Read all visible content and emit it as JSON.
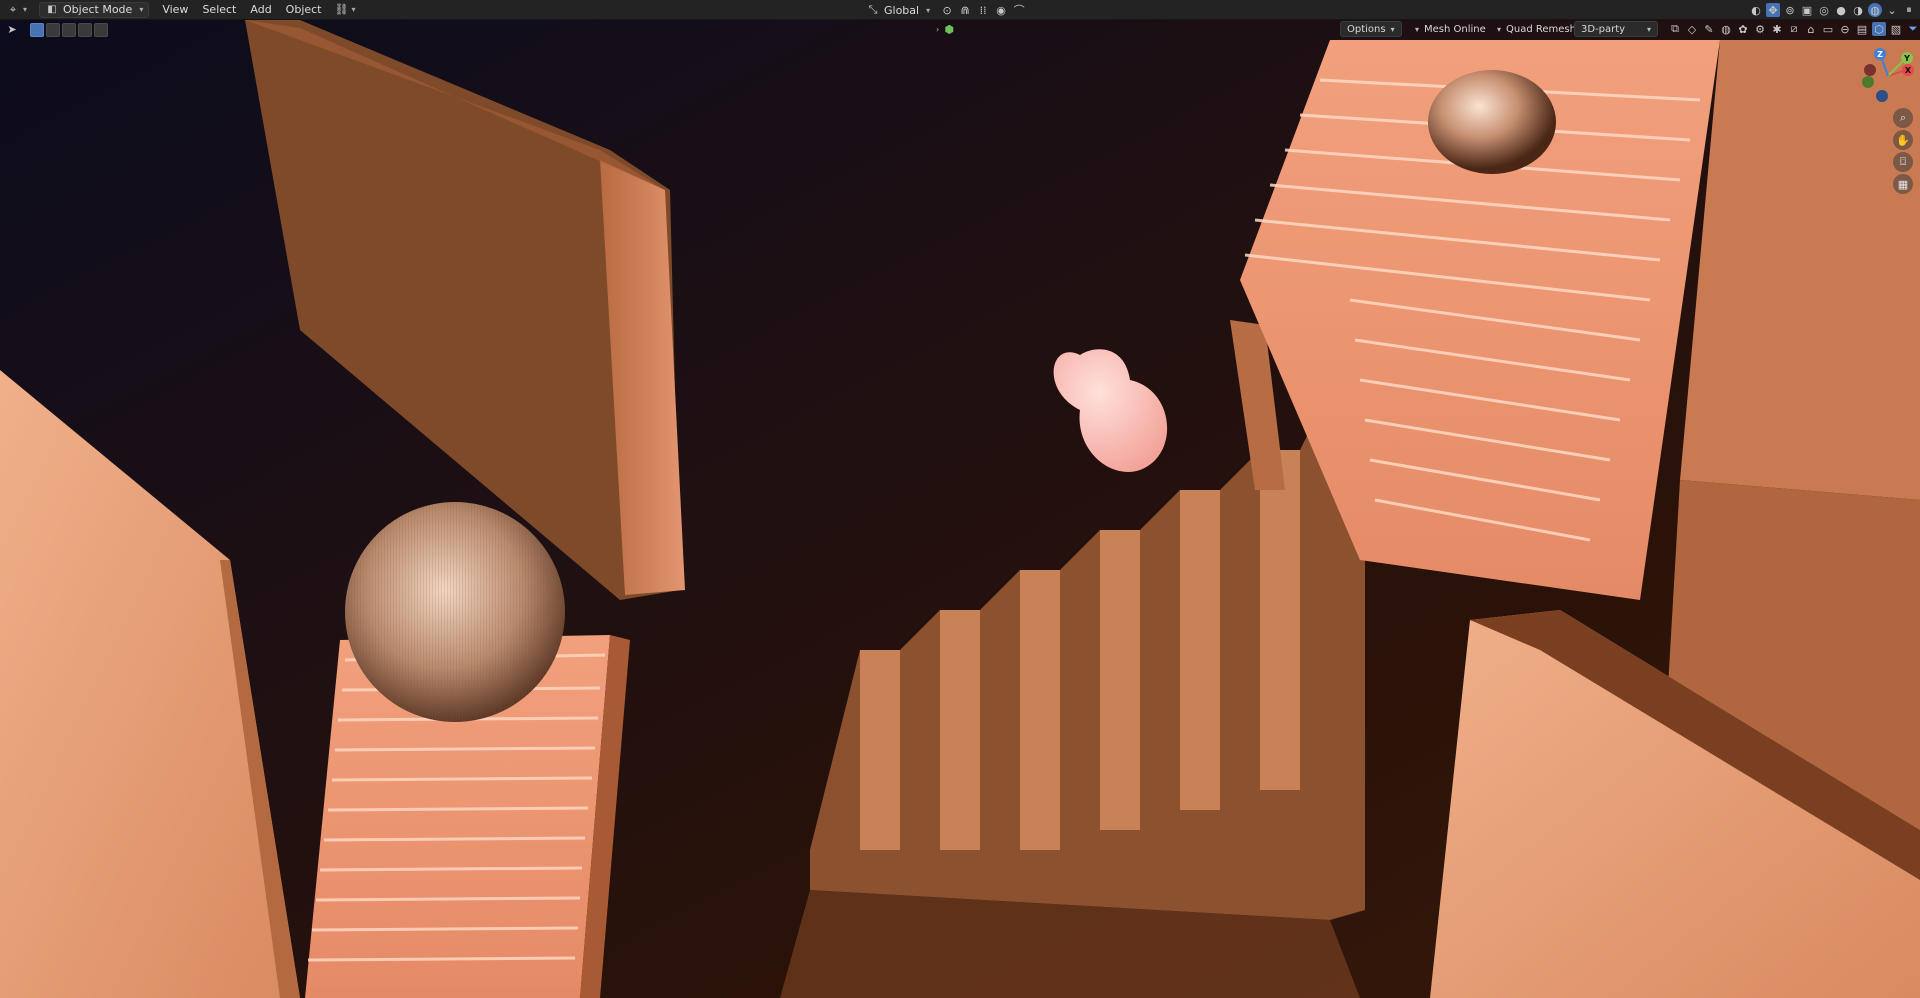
{
  "header": {
    "editor_type_icon": "3d-viewport-icon",
    "mode_label": "Object Mode",
    "menus": [
      "View",
      "Select",
      "Add",
      "Object"
    ],
    "transform_orientation": "Global",
    "pivot_icon": "pivot-icon",
    "snap_icon": "snap-magnet-icon",
    "proportional_icon": "proportional-edit-icon"
  },
  "tool_header": {
    "options_label": "Options",
    "addons": [
      "Mesh Online",
      "Quad Remesh"
    ],
    "dropdown_value": "3D-party",
    "breadcrumb_icon": "collection-icon"
  },
  "gizmo": {
    "axes": [
      "X",
      "Y",
      "Z"
    ],
    "colors": {
      "x": "#e14b4b",
      "y": "#8bc34a",
      "z": "#3f7fd8"
    },
    "nav_icons": [
      "zoom-icon",
      "pan-hand-icon",
      "camera-icon",
      "grid-icon"
    ]
  },
  "colors": {
    "header_bg": "#232323",
    "accent": "#4772b3",
    "copper": "#d9875e",
    "shadow": "#1a0c06"
  }
}
